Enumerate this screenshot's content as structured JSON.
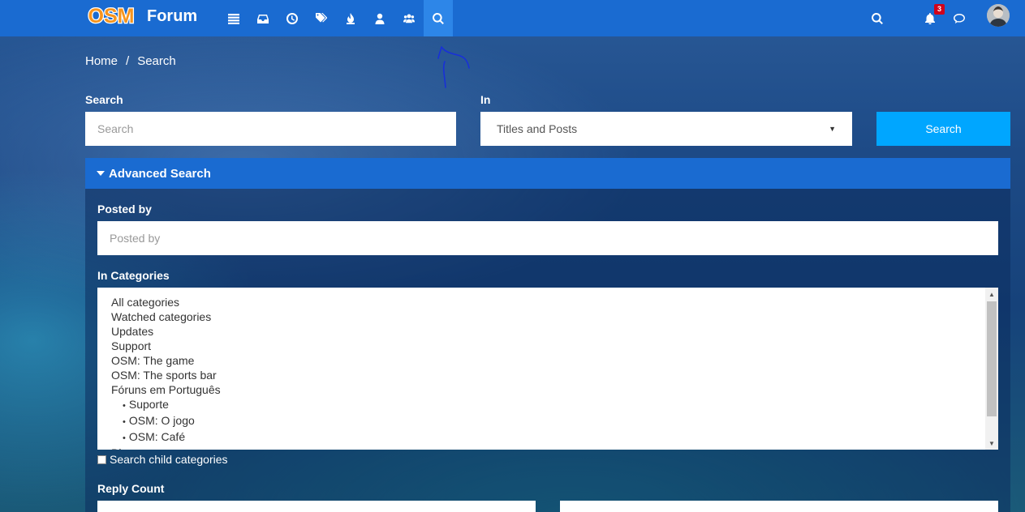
{
  "nav": {
    "logo_text": "OSM",
    "brand": "Forum",
    "icons": [
      {
        "name": "categories-icon"
      },
      {
        "name": "unread-icon"
      },
      {
        "name": "recent-icon"
      },
      {
        "name": "tags-icon"
      },
      {
        "name": "popular-icon"
      },
      {
        "name": "users-icon"
      },
      {
        "name": "groups-icon"
      },
      {
        "name": "search-icon",
        "active": true
      }
    ],
    "notification_count": "3"
  },
  "breadcrumb": {
    "home": "Home",
    "separator": "/",
    "current": "Search"
  },
  "search": {
    "label": "Search",
    "placeholder": "Search",
    "in_label": "In",
    "in_value": "Titles and Posts",
    "button": "Search"
  },
  "advanced": {
    "title": "Advanced Search",
    "posted_by_label": "Posted by",
    "posted_by_placeholder": "Posted by",
    "in_categories_label": "In Categories",
    "categories": [
      {
        "label": "All categories",
        "child": false
      },
      {
        "label": "Watched categories",
        "child": false
      },
      {
        "label": "Updates",
        "child": false
      },
      {
        "label": "Support",
        "child": false
      },
      {
        "label": "OSM: The game",
        "child": false
      },
      {
        "label": "OSM: The sports bar",
        "child": false
      },
      {
        "label": "Fóruns em Português",
        "child": false
      },
      {
        "label": "Suporte",
        "child": true
      },
      {
        "label": "OSM: O jogo",
        "child": true
      },
      {
        "label": "OSM: Café",
        "child": true
      },
      {
        "label": "Blog",
        "child": false
      }
    ],
    "search_child_label": "Search child categories",
    "reply_count_label": "Reply Count"
  },
  "colors": {
    "nav_bg": "#1a6bd1",
    "accent_button": "#00a6ff",
    "badge": "#d0021b"
  }
}
